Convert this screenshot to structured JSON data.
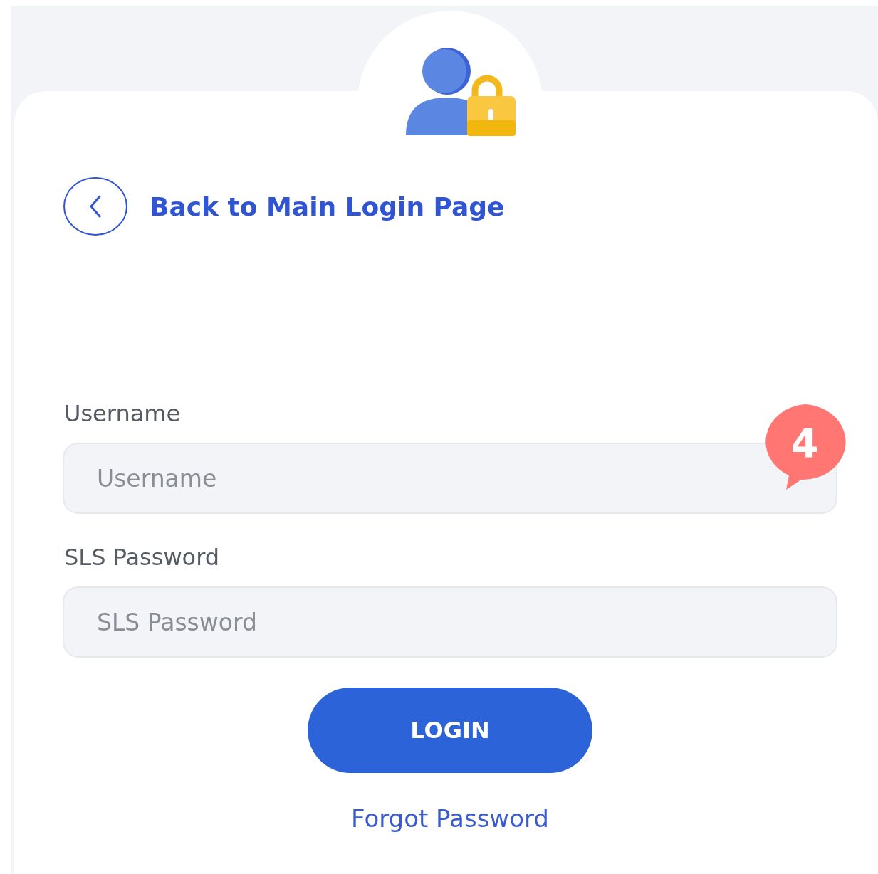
{
  "back_link": {
    "label": "Back to Main Login Page"
  },
  "fields": [
    {
      "label": "Username",
      "placeholder": "Username"
    },
    {
      "label": "SLS Password",
      "placeholder": "SLS Password"
    }
  ],
  "badge": {
    "label": "4"
  },
  "login_button": {
    "label": "LOGIN"
  },
  "forgot_link": {
    "label": "Forgot Password"
  }
}
